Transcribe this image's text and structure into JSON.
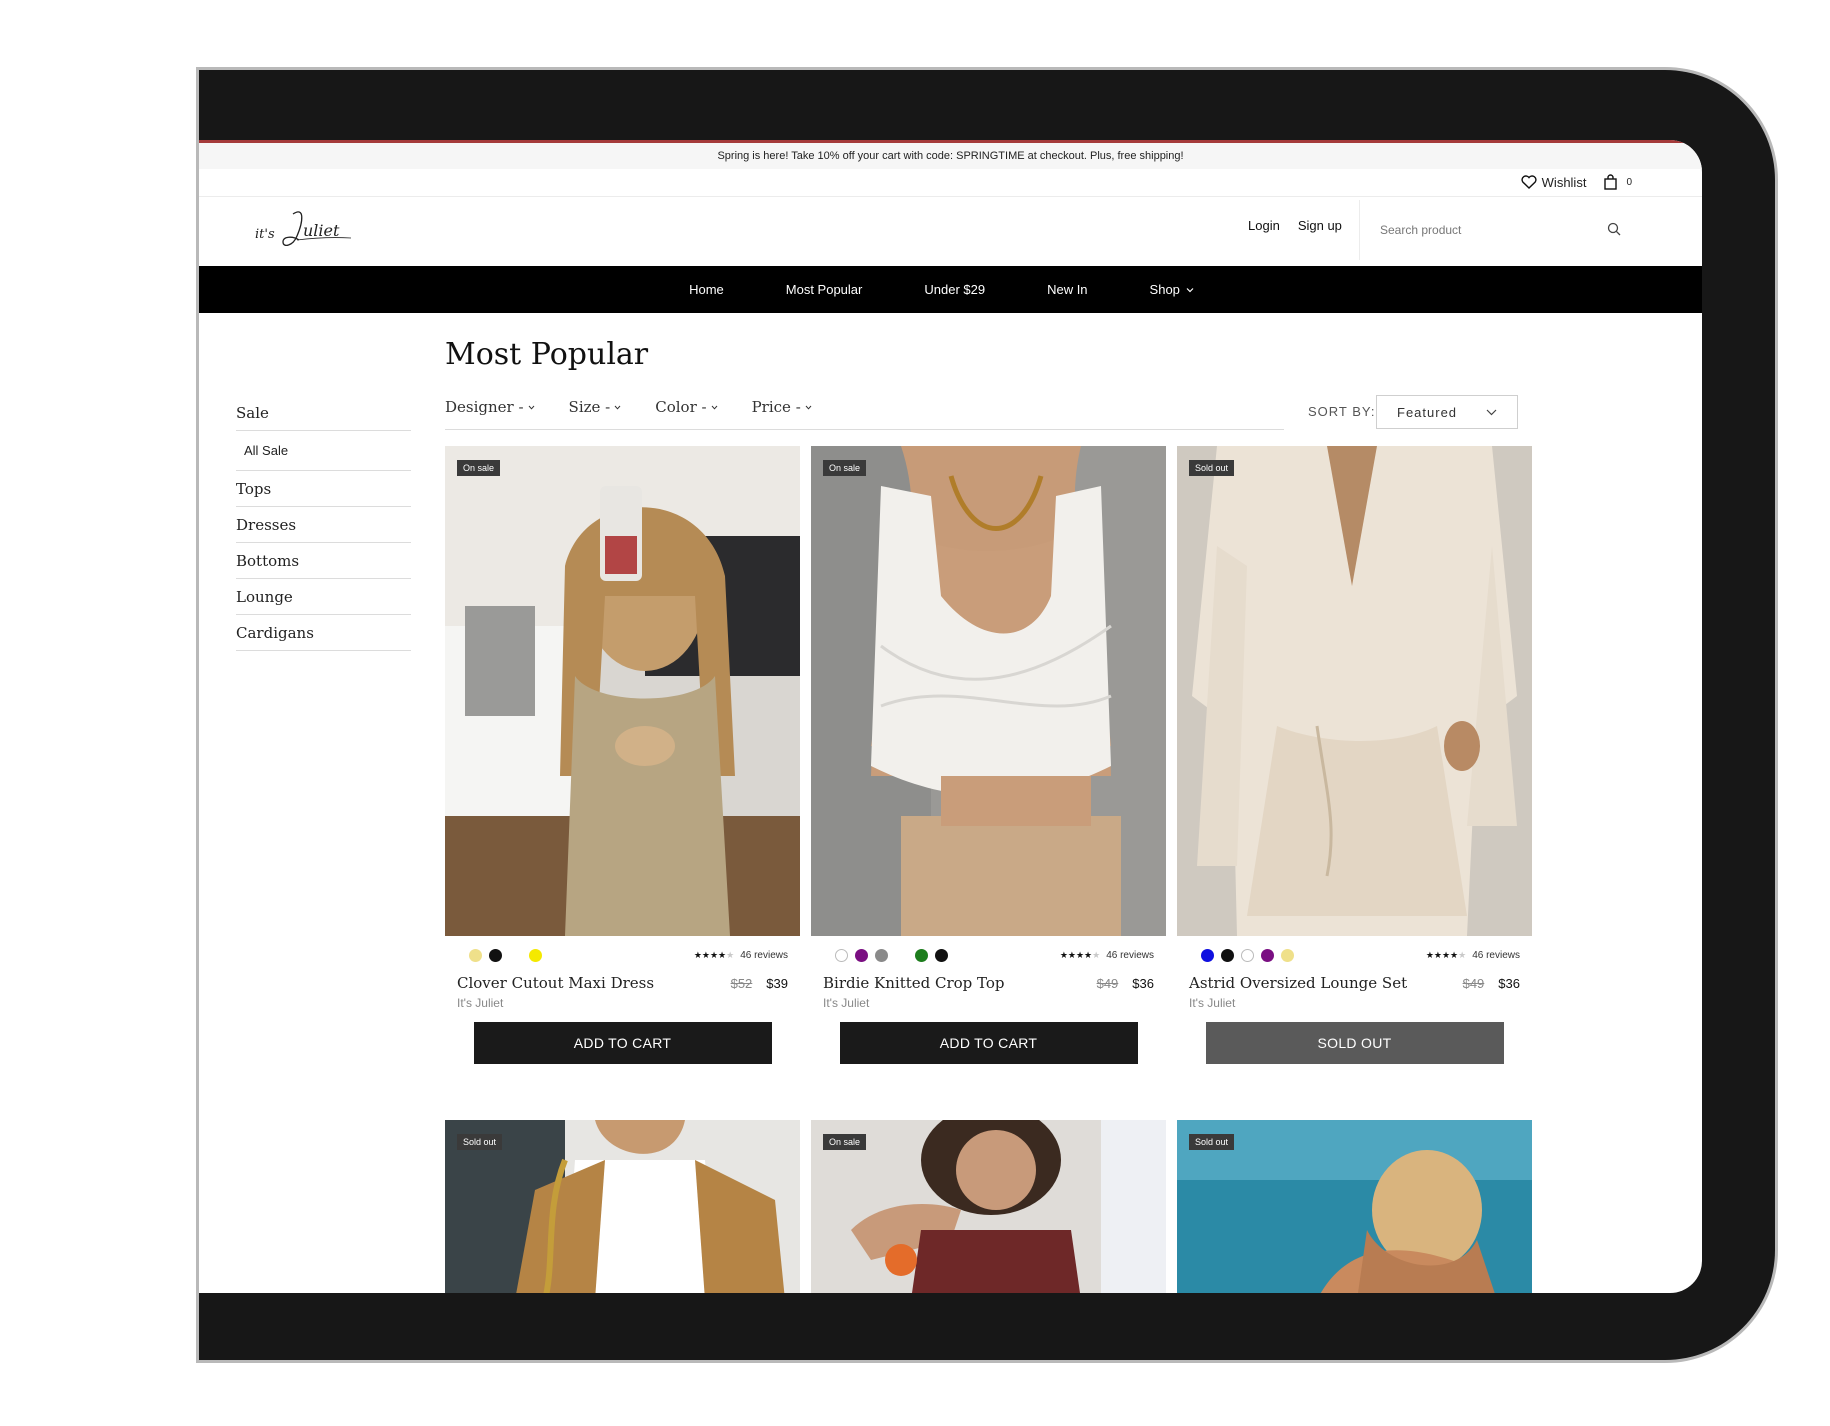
{
  "announcement": "Spring is here! Take 10% off your cart with code: SPRINGTIME at checkout. Plus, free shipping!",
  "utility": {
    "wishlist": "Wishlist",
    "cart_count": "0"
  },
  "header": {
    "login": "Login",
    "signup": "Sign up",
    "search_placeholder": "Search product"
  },
  "nav": [
    "Home",
    "Most Popular",
    "Under $29",
    "New In",
    "Shop"
  ],
  "page_title": "Most Popular",
  "sidebar": {
    "sale": "Sale",
    "all_sale": "All Sale",
    "items": [
      "Tops",
      "Dresses",
      "Bottoms",
      "Lounge",
      "Cardigans"
    ]
  },
  "filters": [
    "Designer -",
    "Size -",
    "Color -",
    "Price -"
  ],
  "sort": {
    "label": "SORT BY:",
    "value": "Featured"
  },
  "products": [
    {
      "badge": "On sale",
      "name": "Clover Cutout Maxi Dress",
      "brand": "It's Juliet",
      "old_price": "$52",
      "price": "$39",
      "reviews": "46 reviews",
      "rating": 4,
      "colors": [
        "#efe08a",
        "#111111",
        "#ffffff",
        "#f4e900"
      ],
      "cta": "ADD TO CART",
      "sold_out": false
    },
    {
      "badge": "On sale",
      "name": "Birdie Knitted Crop Top",
      "brand": "It's Juliet",
      "old_price": "$49",
      "price": "$36",
      "reviews": "46 reviews",
      "rating": 4,
      "colors": [
        "#ffffff",
        "#7a0f82",
        "#8a8a8a",
        "#ffffff",
        "#1d7d1d",
        "#111111"
      ],
      "cta": "ADD TO CART",
      "sold_out": false
    },
    {
      "badge": "Sold out",
      "name": "Astrid Oversized Lounge Set",
      "brand": "It's Juliet",
      "old_price": "$49",
      "price": "$36",
      "reviews": "46 reviews",
      "rating": 4,
      "colors": [
        "#1010e0",
        "#111111",
        "#ffffff",
        "#7a0f82",
        "#efe08a"
      ],
      "cta": "SOLD OUT",
      "sold_out": true
    },
    {
      "badge": "Sold out"
    },
    {
      "badge": "On sale"
    },
    {
      "badge": "Sold out"
    }
  ]
}
